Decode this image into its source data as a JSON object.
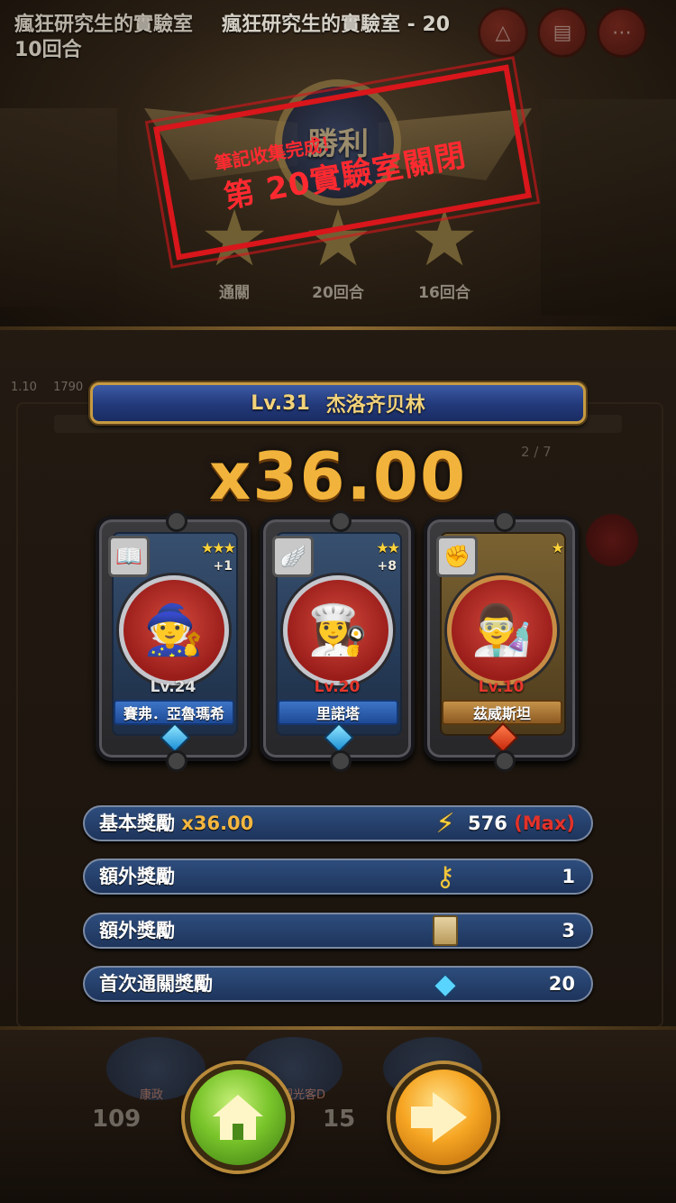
{
  "header": {
    "title_line1": "瘋狂研究生的實驗室",
    "title_line2": "10回合",
    "title_ghost": "瘋狂研究生的實驗室 - 20"
  },
  "victory": {
    "label": "勝利",
    "stars": [
      {
        "label": "通關"
      },
      {
        "label": "20回合"
      },
      {
        "label": "16回合"
      }
    ]
  },
  "stamp": {
    "subtitle": "筆記收集完成！",
    "main": "第 20實驗室關閉"
  },
  "faint": {
    "stat_a": "1.10",
    "stat_b": "1790",
    "count": "2 / 7"
  },
  "player": {
    "level": "Lv.31",
    "name": "杰洛齐贝林"
  },
  "multiplier": "x36.00",
  "heroes": [
    {
      "class_icon": "book-icon",
      "stars": "★★★",
      "plus": "+1",
      "portrait": "🧙",
      "level": "Lv.24",
      "level_color": "#e2e2e2",
      "name": "賽弗．亞魯瑪希"
    },
    {
      "class_icon": "wings-icon",
      "stars": "★★",
      "plus": "+8",
      "portrait": "👩‍🍳",
      "level": "Lv.20",
      "level_color": "#e5372d",
      "name": "里諾塔"
    },
    {
      "class_icon": "fist-icon",
      "stars": "★",
      "plus": "",
      "portrait": "👨‍🔬",
      "level": "Lv.10",
      "level_color": "#e5372d",
      "name": "茲威斯坦"
    }
  ],
  "rewards": [
    {
      "label": "基本獎勵",
      "mult": "x36.00",
      "icon": "lightning-icon",
      "value": "576",
      "extra": "(Max)"
    },
    {
      "label": "額外獎勵",
      "mult": "",
      "icon": "key-icon",
      "value": "1",
      "extra": ""
    },
    {
      "label": "額外獎勵",
      "mult": "",
      "icon": "scroll-icon",
      "value": "3",
      "extra": ""
    },
    {
      "label": "首次通關獎勵",
      "mult": "",
      "icon": "diamond-icon",
      "value": "20",
      "extra": ""
    }
  ],
  "bottom": {
    "ghost_left_label": "康政",
    "ghost_mid_label": "觀光客D",
    "ghost_left_num": "109",
    "ghost_mid_num": "15"
  },
  "colors": {
    "accent_gold": "#f1b33b",
    "stamp_red": "#d8161b",
    "banner_blue": "#22397a",
    "home_green": "#7ac52b",
    "next_orange": "#f6a623"
  }
}
